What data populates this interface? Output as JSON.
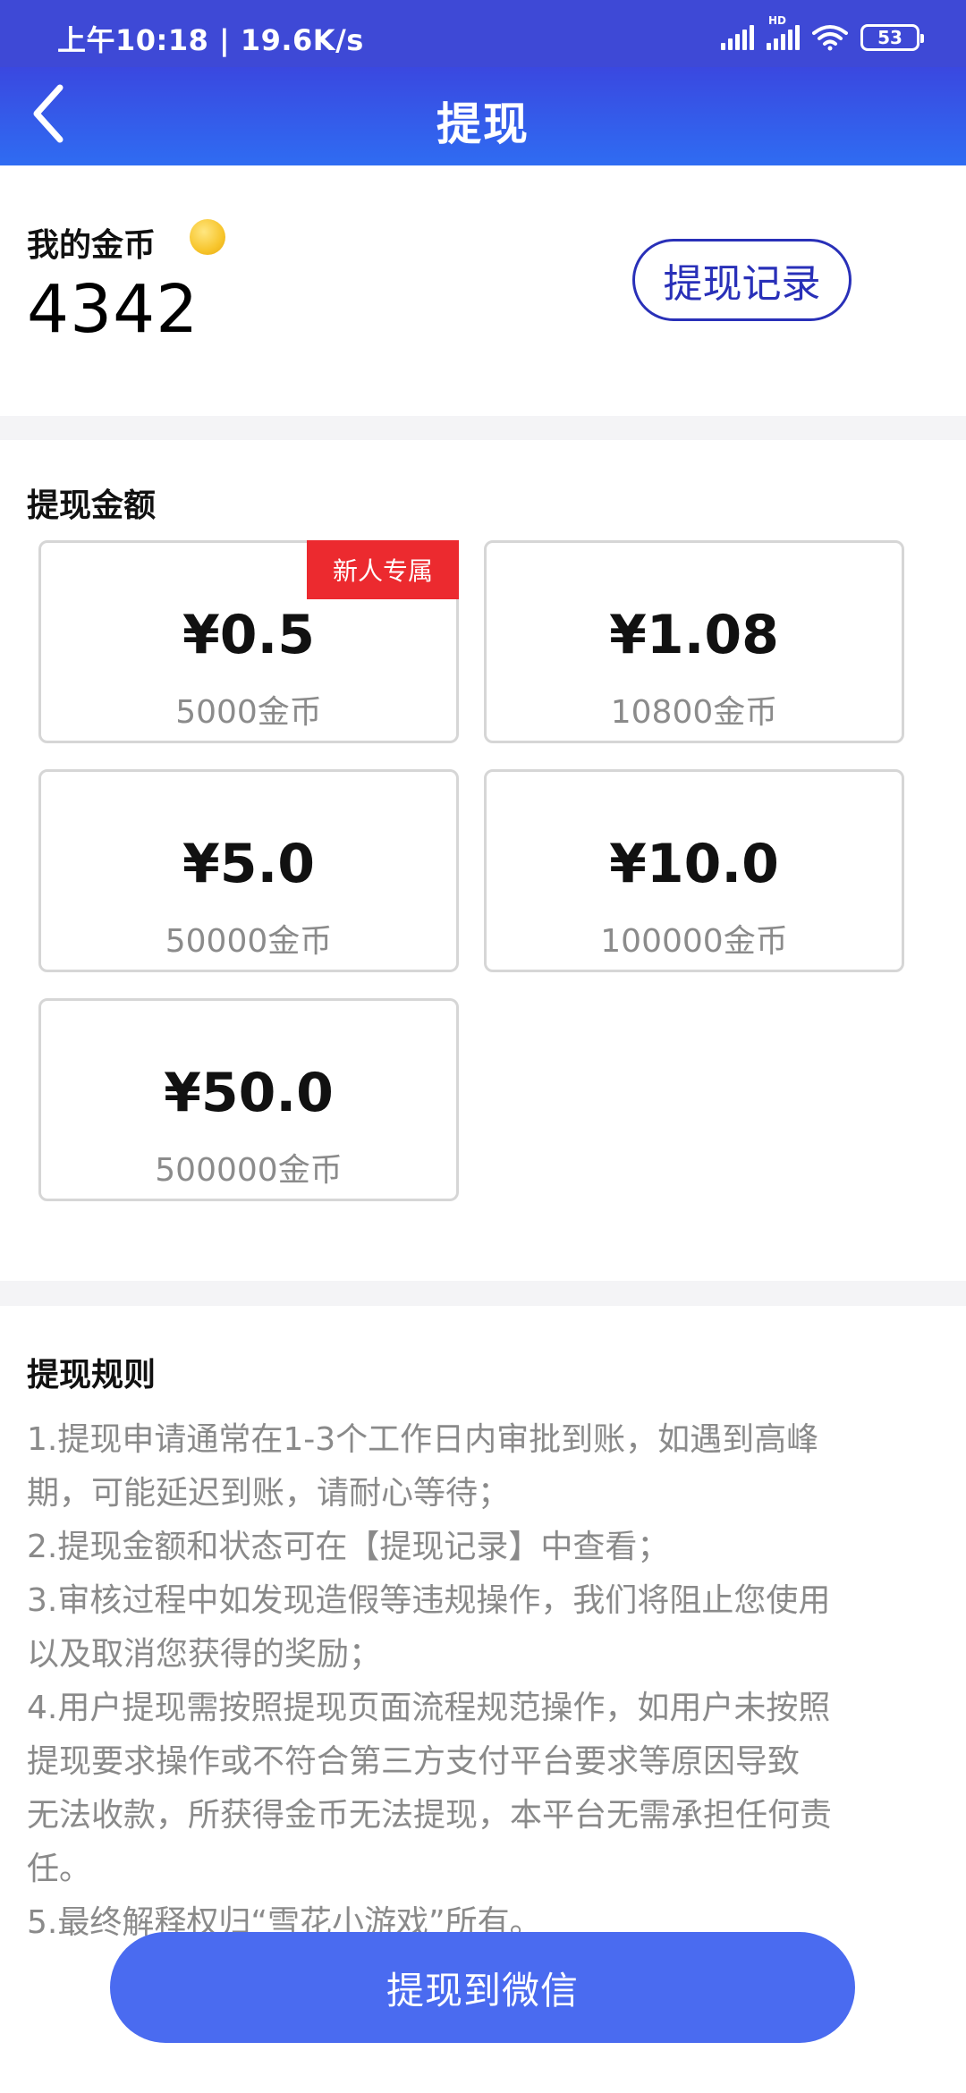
{
  "status_bar": {
    "time": "上午10:18 | 19.6K/s",
    "hd_label": "HD",
    "battery": "53",
    "icons": [
      "signal-icon",
      "hd-signal-icon",
      "wifi-icon",
      "battery-icon"
    ]
  },
  "header": {
    "title": "提现",
    "back_icon": "chevron-left-icon"
  },
  "coins": {
    "label": "我的金币",
    "value": "4342",
    "icon": "gold-coin-icon",
    "record_button": "提现记录"
  },
  "amount": {
    "title": "提现金额",
    "options": [
      {
        "price": "¥0.5",
        "coins": "5000金币",
        "badge": "新人专属"
      },
      {
        "price": "¥1.08",
        "coins": "10800金币"
      },
      {
        "price": "¥5.0",
        "coins": "50000金币"
      },
      {
        "price": "¥10.0",
        "coins": "100000金币"
      },
      {
        "price": "¥50.0",
        "coins": "500000金币"
      }
    ]
  },
  "rules": {
    "title": "提现规则",
    "lines": [
      " 1.提现申请通常在1-3个工作日内审批到账，如遇到高峰",
      "期，可能延迟到账，请耐心等待；",
      " 2.提现金额和状态可在【提现记录】中查看；",
      " 3.审核过程中如发现造假等违规操作，我们将阻止您使用",
      "以及取消您获得的奖励；",
      " 4.用户提现需按照提现页面流程规范操作，如用户未按照",
      "提现要求操作或不符合第三方支付平台要求等原因导致",
      "无法收款，所获得金币无法提现，本平台无需承担任何责",
      "任。",
      " 5.最终解释权归“雪花小游戏”所有。"
    ]
  },
  "submit_button": "提现到微信",
  "colors": {
    "header": "#3a48e0",
    "accent": "#2930b8",
    "button": "#4a6bf0",
    "badge": "#ec2a2f"
  }
}
